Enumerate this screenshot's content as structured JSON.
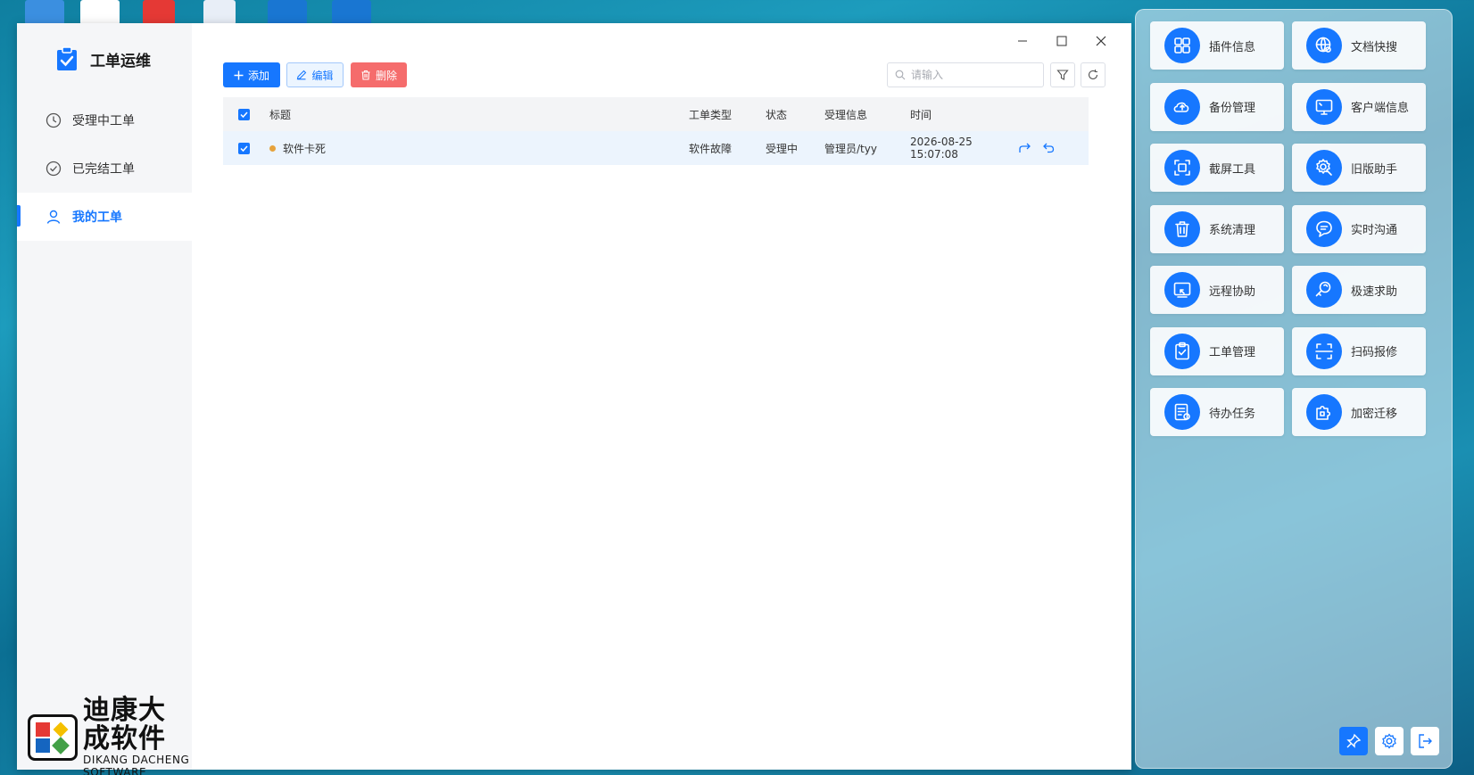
{
  "app": {
    "title": "工单运维"
  },
  "sidebar": {
    "items": [
      {
        "label": "受理中工单",
        "icon": "clock-icon"
      },
      {
        "label": "已完结工单",
        "icon": "check-circle-icon"
      },
      {
        "label": "我的工单",
        "icon": "user-icon",
        "active": true
      }
    ]
  },
  "logo": {
    "cn": "迪康大成软件",
    "en": "DIKANG DACHENG SOFTWARE"
  },
  "toolbar": {
    "add_label": "添加",
    "edit_label": "编辑",
    "delete_label": "删除",
    "search_placeholder": "请输入"
  },
  "table": {
    "headers": {
      "title": "标题",
      "type": "工单类型",
      "status": "状态",
      "info": "受理信息",
      "time": "时间"
    },
    "rows": [
      {
        "title": "软件卡死",
        "type": "软件故障",
        "status": "受理中",
        "info": "管理员/tyy",
        "time": "2026-08-25 15:07:08"
      }
    ]
  },
  "panel": {
    "tools": [
      {
        "label": "插件信息",
        "icon": "grid-icon"
      },
      {
        "label": "文档快搜",
        "icon": "globe-search-icon"
      },
      {
        "label": "备份管理",
        "icon": "cloud-upload-icon"
      },
      {
        "label": "客户端信息",
        "icon": "monitor-icon"
      },
      {
        "label": "截屏工具",
        "icon": "screenshot-icon"
      },
      {
        "label": "旧版助手",
        "icon": "gear-wrench-icon"
      },
      {
        "label": "系统清理",
        "icon": "trash-icon"
      },
      {
        "label": "实时沟通",
        "icon": "chat-icon"
      },
      {
        "label": "远程协助",
        "icon": "remote-screen-icon"
      },
      {
        "label": "极速求助",
        "icon": "search-key-icon"
      },
      {
        "label": "工单管理",
        "icon": "clipboard-check-icon"
      },
      {
        "label": "扫码报修",
        "icon": "scan-icon"
      },
      {
        "label": "待办任务",
        "icon": "task-list-icon"
      },
      {
        "label": "加密迁移",
        "icon": "puzzle-lock-icon"
      }
    ]
  },
  "colors": {
    "accent": "#1677ff",
    "danger": "#f56c6c",
    "status_dot": "#e6a23c"
  }
}
